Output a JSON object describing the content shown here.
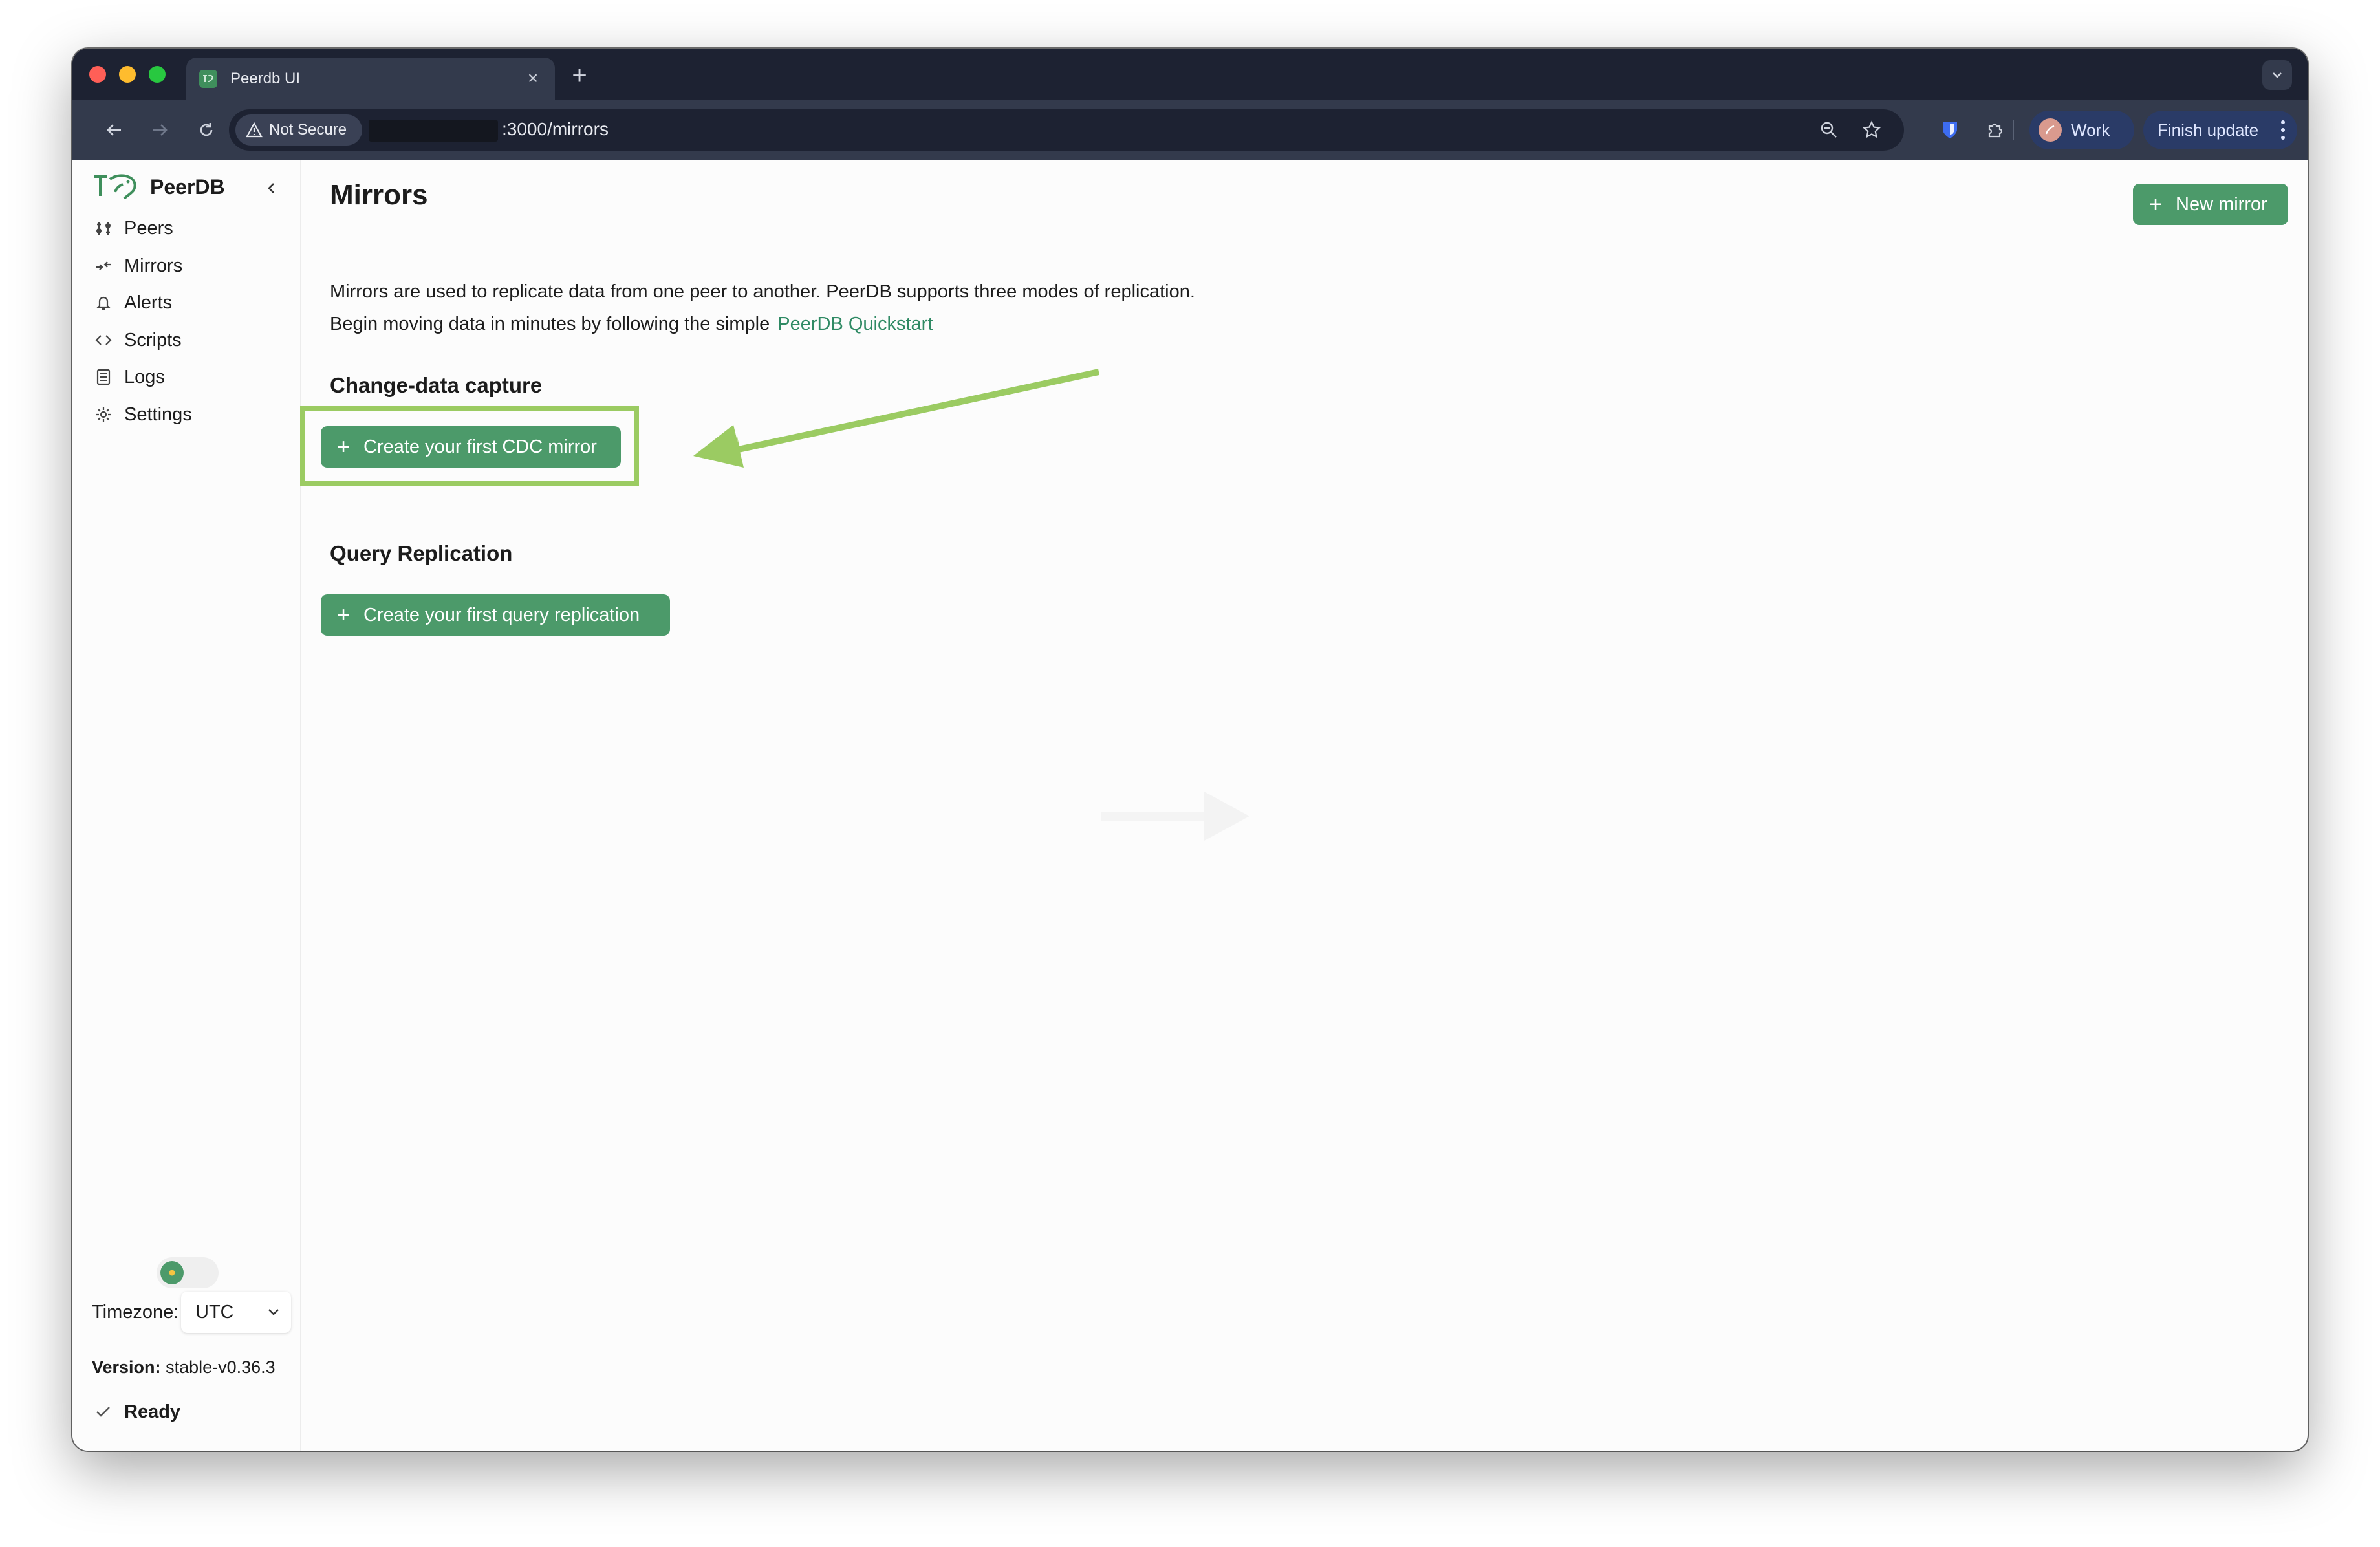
{
  "browser": {
    "tab_title": "Peerdb UI",
    "security_label": "Not Secure",
    "url_visible": ":3000/mirrors",
    "profile_label": "Work",
    "update_label": "Finish update"
  },
  "sidebar": {
    "brand": "PeerDB",
    "items": [
      {
        "label": "Peers",
        "icon": "peers-icon"
      },
      {
        "label": "Mirrors",
        "icon": "mirrors-icon"
      },
      {
        "label": "Alerts",
        "icon": "bell-icon"
      },
      {
        "label": "Scripts",
        "icon": "code-icon"
      },
      {
        "label": "Logs",
        "icon": "logs-icon"
      },
      {
        "label": "Settings",
        "icon": "gear-icon"
      }
    ],
    "timezone_label": "Timezone:",
    "timezone_value": "UTC",
    "version_label": "Version:",
    "version_value": "stable-v0.36.3",
    "status": "Ready"
  },
  "main": {
    "title": "Mirrors",
    "new_mirror_label": "New mirror",
    "desc_line1": "Mirrors are used to replicate data from one peer to another. PeerDB supports three modes of replication.",
    "desc_line2": "Begin moving data in minutes by following the simple",
    "quickstart_link": "PeerDB Quickstart",
    "cdc_section": "Change-data capture",
    "cdc_button": "Create your first CDC mirror",
    "query_section": "Query Replication",
    "query_button": "Create your first query replication"
  },
  "colors": {
    "accent_green": "#4c9a6a",
    "highlight": "#9bcb62",
    "link": "#2f8a64"
  }
}
